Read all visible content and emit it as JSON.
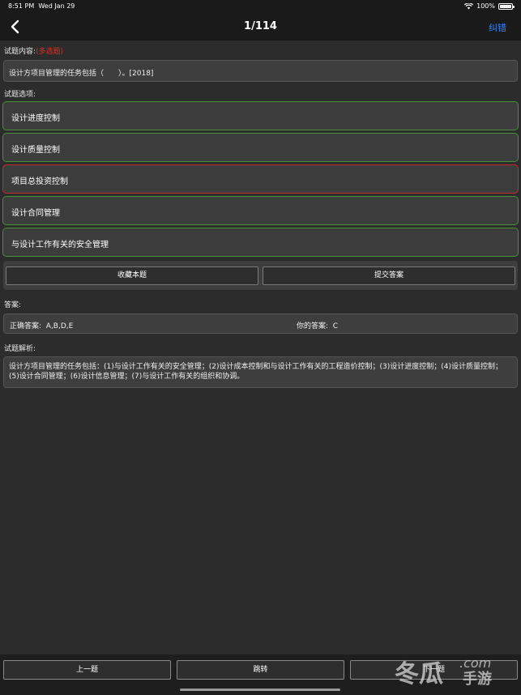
{
  "status": {
    "time": "8:51 PM",
    "date": "Wed Jan 29",
    "battery": "100%"
  },
  "nav": {
    "title": "1/114",
    "right_action": "纠错"
  },
  "question_section": {
    "label": "试题内容:",
    "type_tag": "(多选题)",
    "text": "设计方项目管理的任务包括（　　）。[2018]"
  },
  "options_section": {
    "label": "试题选项:",
    "options": [
      {
        "text": "设计进度控制",
        "state": "correct"
      },
      {
        "text": "设计质量控制",
        "state": "correct"
      },
      {
        "text": "项目总投资控制",
        "state": "wrong"
      },
      {
        "text": "设计合同管理",
        "state": "correct"
      },
      {
        "text": "与设计工作有关的安全管理",
        "state": "correct"
      }
    ]
  },
  "actions": {
    "favorite": "收藏本题",
    "submit": "提交答案"
  },
  "answer_section": {
    "label": "答案:",
    "correct_label": "正确答案:",
    "correct_value": "A,B,D,E",
    "your_label": "你的答案:",
    "your_value": "C"
  },
  "analysis_section": {
    "label": "试题解析:",
    "text": "设计方项目管理的任务包括：(1)与设计工作有关的安全管理；(2)设计成本控制和与设计工作有关的工程造价控制；(3)设计进度控制；(4)设计质量控制；(5)设计合同管理；(6)设计信息管理；(7)与设计工作有关的组织和协调。"
  },
  "bottom": {
    "prev": "上一题",
    "jump": "跳转",
    "next": "下一题"
  },
  "watermark": {
    "brand": "冬瓜",
    "site": ".com",
    "sub": "手游"
  },
  "colors": {
    "accent": "#2f86ff",
    "correct_border": "#4a8f3a",
    "wrong_border": "#c42e2e",
    "tag_red": "#d8322b"
  }
}
